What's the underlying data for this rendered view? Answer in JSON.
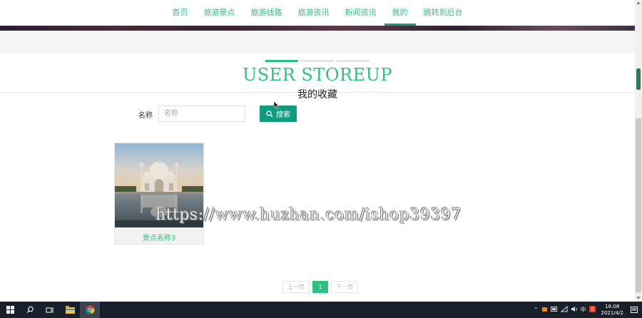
{
  "nav": {
    "items": [
      {
        "label": "首页"
      },
      {
        "label": "旅游景点"
      },
      {
        "label": "旅游线路"
      },
      {
        "label": "旅游资讯"
      },
      {
        "label": "新闻资讯"
      },
      {
        "label": "我的"
      },
      {
        "label": "跳转到后台"
      }
    ],
    "active": "我的"
  },
  "section": {
    "title_en": "USER STOREUP",
    "title_cn": "我的收藏"
  },
  "search": {
    "label": "名称",
    "placeholder": "名称",
    "value": "",
    "button_label": "搜索"
  },
  "items": [
    {
      "name": "景点名称3"
    }
  ],
  "watermark": "https://www.huzhan.com/ishop39397",
  "pagination": {
    "prev": "上一页",
    "current": "1",
    "next": "下一页"
  },
  "taskbar": {
    "ime": "中",
    "time": "16:08",
    "date": "2021/4/2"
  },
  "colors": {
    "accent": "#2fbf82",
    "button": "#0e9b80",
    "taskbar": "#17202a"
  }
}
